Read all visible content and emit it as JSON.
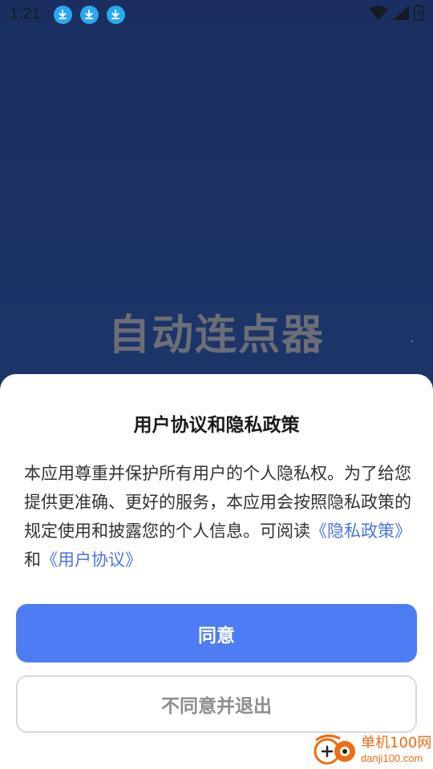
{
  "status_bar": {
    "time": "1:21",
    "notifications": [
      "download-icon",
      "download-icon",
      "download-icon"
    ]
  },
  "background_app": {
    "title": "自动连点器",
    "subtitle": "… … … …"
  },
  "dialog": {
    "title": "用户协议和隐私政策",
    "body_text": "本应用尊重并保护所有用户的个人隐私权。为了给您提供更准确、更好的服务，本应用会按照隐私政策的规定使用和披露您的个人信息。可阅读",
    "privacy_link": "《隐私政策》",
    "conjunction": "和",
    "user_agreement_link": "《用户协议》",
    "agree_button": "同意",
    "decline_button": "不同意并退出"
  },
  "watermark": {
    "name_cn": "单机100网",
    "domain": "danji100.com"
  },
  "colors": {
    "background": "#1c3365",
    "primary_button": "#4e7cf2",
    "link": "#4a74e0",
    "download_badge": "#2aa8f2",
    "watermark": "#ee6c13"
  }
}
